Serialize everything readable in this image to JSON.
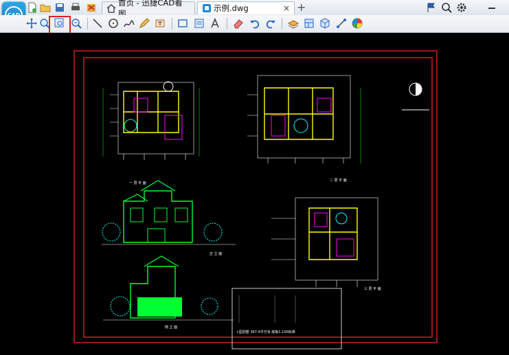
{
  "tabs": [
    {
      "label": "首页 - 迅捷CAD看图",
      "active": false
    },
    {
      "label": "示例.dwg",
      "active": true,
      "close": "×"
    }
  ],
  "new_tab": "+",
  "app_logo": "CAD",
  "quick_icons": [
    "new-file-icon",
    "open-folder-icon",
    "save-icon",
    "print-icon",
    "cut-icon"
  ],
  "right_controls": [
    "flag-icon",
    "zoom-icon",
    "gear-icon",
    "minimize-icon"
  ],
  "toolbar_icons": [
    "pan-icon",
    "zoom-window-icon",
    "zoom-extents-icon",
    "zoom-realtime-icon",
    "line-icon",
    "circle-icon",
    "polyline-icon",
    "pencil-icon",
    "text-edit-icon",
    "rectangle-icon",
    "block-icon",
    "text-icon",
    "eraser-icon",
    "undo-icon",
    "redo-icon",
    "layer-icon",
    "layout-icon",
    "3d-view-icon",
    "measure-icon",
    "color-icon"
  ],
  "drawing": {
    "plan_label_1": "一 层 平 面",
    "plan_label_2": "二 层 平 面",
    "plan_label_3": "三 层 平 面",
    "elev_label_1": "正 立 面",
    "elev_label_2": "侧 立 面",
    "title_block_text": "L型别墅   367.4平方米   底板1:100标准",
    "colors": {
      "frame": "#e0201a",
      "wall": "#ffff00",
      "elevation": "#00ff33",
      "tree": "#00ffff",
      "dim": "#ffffff",
      "accent": "#ff00ff"
    }
  }
}
